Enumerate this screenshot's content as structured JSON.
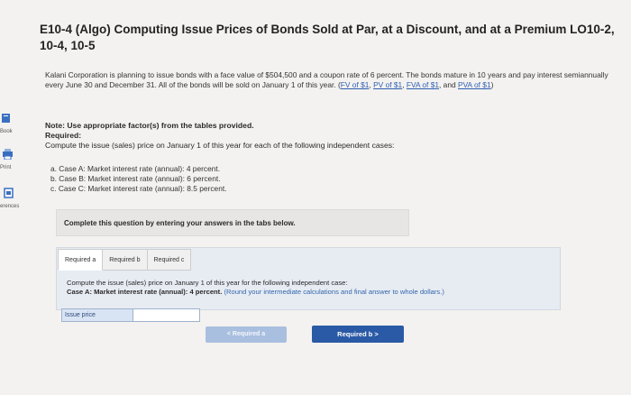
{
  "sidebar": {
    "items": [
      {
        "label": "Book",
        "icon": "book-icon"
      },
      {
        "label": "Print",
        "icon": "print-icon"
      },
      {
        "label": "erences",
        "icon": "references-icon"
      }
    ]
  },
  "problem": {
    "title": "E10-4 (Algo) Computing Issue Prices of Bonds Sold at Par, at a Discount, and at a Premium LO10-2, 10-4, 10-5",
    "intro_text": "Kalani Corporation is planning to issue bonds with a face value of $504,500 and a coupon rate of 6 percent. The bonds mature in 10 years and pay interest semiannually every June 30 and December 31. All of the bonds will be sold on January 1 of this year.",
    "links": [
      "FV of $1",
      "PV of $1",
      "FVA of $1",
      "PVA of $1"
    ],
    "note": "Note: Use appropriate factor(s) from the tables provided.",
    "required_label": "Required:",
    "required_text": "Compute the issue (sales) price on January 1 of this year for each of the following independent cases:",
    "cases": [
      "a. Case A: Market interest rate (annual): 4 percent.",
      "b. Case B: Market interest rate (annual): 6 percent.",
      "c. Case C: Market interest rate (annual): 8.5 percent."
    ]
  },
  "instruction": "Complete this question by entering your answers in the tabs below.",
  "tabs": [
    "Required a",
    "Required b",
    "Required c"
  ],
  "panel": {
    "line1": "Compute the issue (sales) price on January 1 of this year for the following independent case:",
    "line2_main": "Case A: Market interest rate (annual): 4 percent.",
    "line2_hint": "(Round your intermediate calculations and final answer to whole dollars.)"
  },
  "answer": {
    "label": "Issue price",
    "value": ""
  },
  "nav": {
    "prev": "< Required a",
    "next": "Required b >"
  }
}
